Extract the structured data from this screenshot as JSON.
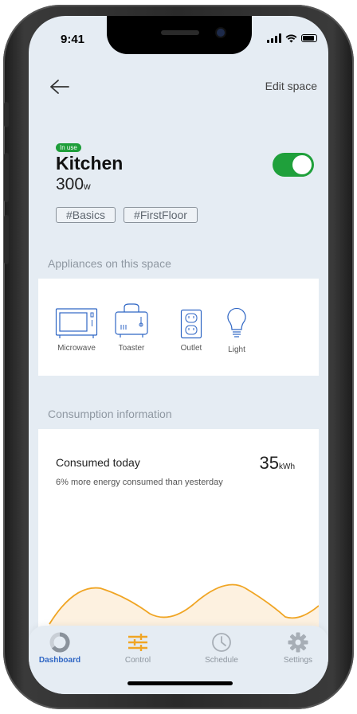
{
  "status": {
    "time": "9:41"
  },
  "header": {
    "back_icon": "arrow-left-icon",
    "edit_label": "Edit space"
  },
  "space": {
    "badge": "In use",
    "name": "Kitchen",
    "power_value": "300",
    "power_unit": "w",
    "toggle_on": true,
    "tags": [
      "#Basics",
      "#FirstFloor"
    ]
  },
  "appliances": {
    "section_label": "Appliances on this space",
    "items": [
      {
        "label": "Microwave",
        "icon": "microwave-icon"
      },
      {
        "label": "Toaster",
        "icon": "toaster-icon"
      },
      {
        "label": "Outlet",
        "icon": "outlet-icon"
      },
      {
        "label": "Light",
        "icon": "lightbulb-icon"
      }
    ]
  },
  "consumption": {
    "section_label": "Consumption information",
    "title": "Consumed today",
    "subtitle": "6% more energy consumed than yesterday",
    "value": "35",
    "unit": "kWh",
    "line_color": "#f0a524",
    "fill_color": "#fdf1e0"
  },
  "tabbar": {
    "items": [
      {
        "label": "Dashboard",
        "icon": "dashboard-ring-icon",
        "active": true
      },
      {
        "label": "Control",
        "icon": "sliders-icon",
        "active": false
      },
      {
        "label": "Schedule",
        "icon": "clock-icon",
        "active": false
      },
      {
        "label": "Settings",
        "icon": "gear-icon",
        "active": false
      }
    ]
  },
  "colors": {
    "accent_blue": "#2f66c4",
    "accent_green": "#1fa03b",
    "accent_orange": "#f0a524",
    "background": "#e5ecf3"
  }
}
